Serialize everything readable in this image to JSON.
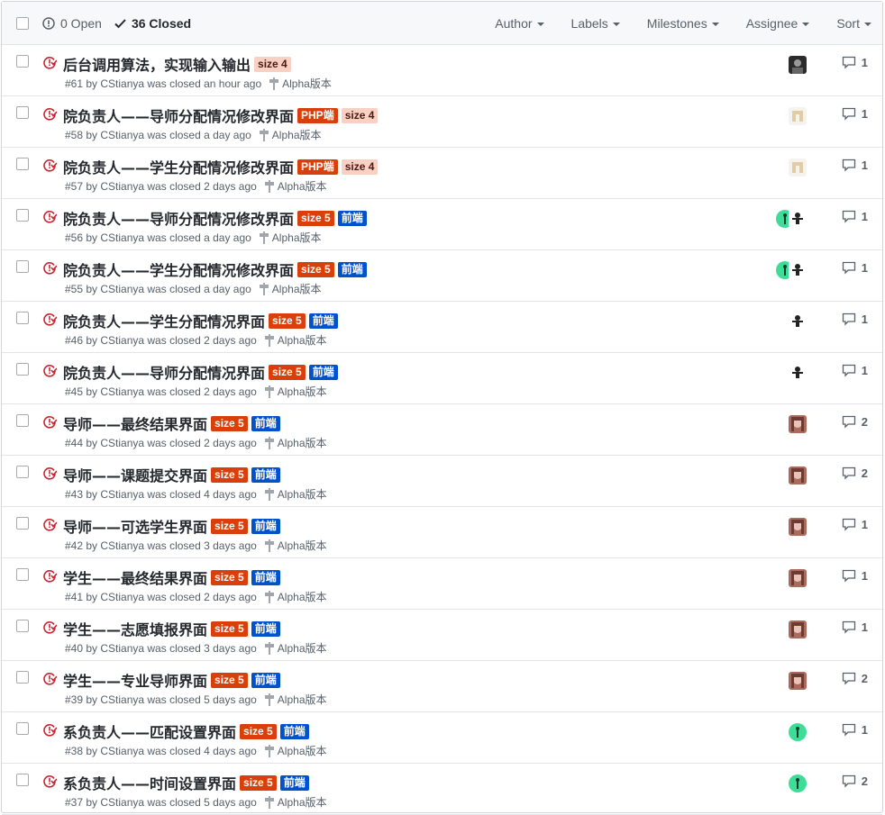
{
  "header": {
    "open_label": "0 Open",
    "closed_label": "36 Closed",
    "filters": [
      "Author",
      "Labels",
      "Milestones",
      "Assignee",
      "Sort"
    ]
  },
  "label_colors": {
    "size 4": {
      "bg": "#f9d0c4",
      "fg": "#4a1a0f"
    },
    "size 5": {
      "bg": "#d93f0b",
      "fg": "#ffffff"
    },
    "PHP端": {
      "bg": "#d93f0b",
      "fg": "#ffffff"
    },
    "前端": {
      "bg": "#0052cc",
      "fg": "#ffffff"
    }
  },
  "closed_icon_color": "#cb2431",
  "issues": [
    {
      "title": "后台调用算法，实现输入输出",
      "labels": [
        "size 4"
      ],
      "meta": "#61 by CStianya was closed an hour ago",
      "milestone": "Alpha版本",
      "avatars": [
        "dark-portrait-avatar"
      ],
      "comments": "1"
    },
    {
      "title": "院负责人——导师分配情况修改界面",
      "labels": [
        "PHP端",
        "size 4"
      ],
      "meta": "#58 by CStianya was closed a day ago",
      "milestone": "Alpha版本",
      "avatars": [
        "pixel-avatar"
      ],
      "comments": "1"
    },
    {
      "title": "院负责人——学生分配情况修改界面",
      "labels": [
        "PHP端",
        "size 4"
      ],
      "meta": "#57 by CStianya was closed 2 days ago",
      "milestone": "Alpha版本",
      "avatars": [
        "pixel-avatar"
      ],
      "comments": "1"
    },
    {
      "title": "院负责人——导师分配情况修改界面",
      "labels": [
        "size 5",
        "前端"
      ],
      "meta": "#56 by CStianya was closed a day ago",
      "milestone": "Alpha版本",
      "avatars": [
        "green-avatar",
        "figure-avatar"
      ],
      "comments": "1"
    },
    {
      "title": "院负责人——学生分配情况修改界面",
      "labels": [
        "size 5",
        "前端"
      ],
      "meta": "#55 by CStianya was closed a day ago",
      "milestone": "Alpha版本",
      "avatars": [
        "green-avatar",
        "figure-avatar"
      ],
      "comments": "1"
    },
    {
      "title": "院负责人——学生分配情况界面",
      "labels": [
        "size 5",
        "前端"
      ],
      "meta": "#46 by CStianya was closed 2 days ago",
      "milestone": "Alpha版本",
      "avatars": [
        "figure-avatar"
      ],
      "comments": "1"
    },
    {
      "title": "院负责人——导师分配情况界面",
      "labels": [
        "size 5",
        "前端"
      ],
      "meta": "#45 by CStianya was closed 2 days ago",
      "milestone": "Alpha版本",
      "avatars": [
        "figure-avatar"
      ],
      "comments": "1"
    },
    {
      "title": "导师——最终结果界面",
      "labels": [
        "size 5",
        "前端"
      ],
      "meta": "#44 by CStianya was closed 2 days ago",
      "milestone": "Alpha版本",
      "avatars": [
        "anime-avatar"
      ],
      "comments": "2"
    },
    {
      "title": "导师——课题提交界面",
      "labels": [
        "size 5",
        "前端"
      ],
      "meta": "#43 by CStianya was closed 4 days ago",
      "milestone": "Alpha版本",
      "avatars": [
        "anime-avatar"
      ],
      "comments": "2"
    },
    {
      "title": "导师——可选学生界面",
      "labels": [
        "size 5",
        "前端"
      ],
      "meta": "#42 by CStianya was closed 3 days ago",
      "milestone": "Alpha版本",
      "avatars": [
        "anime-avatar"
      ],
      "comments": "1"
    },
    {
      "title": "学生——最终结果界面",
      "labels": [
        "size 5",
        "前端"
      ],
      "meta": "#41 by CStianya was closed 2 days ago",
      "milestone": "Alpha版本",
      "avatars": [
        "anime-avatar"
      ],
      "comments": "1"
    },
    {
      "title": "学生——志愿填报界面",
      "labels": [
        "size 5",
        "前端"
      ],
      "meta": "#40 by CStianya was closed 3 days ago",
      "milestone": "Alpha版本",
      "avatars": [
        "anime-avatar"
      ],
      "comments": "1"
    },
    {
      "title": "学生——专业导师界面",
      "labels": [
        "size 5",
        "前端"
      ],
      "meta": "#39 by CStianya was closed 5 days ago",
      "milestone": "Alpha版本",
      "avatars": [
        "anime-avatar"
      ],
      "comments": "2"
    },
    {
      "title": "系负责人——匹配设置界面",
      "labels": [
        "size 5",
        "前端"
      ],
      "meta": "#38 by CStianya was closed 4 days ago",
      "milestone": "Alpha版本",
      "avatars": [
        "green-avatar"
      ],
      "comments": "1"
    },
    {
      "title": "系负责人——时间设置界面",
      "labels": [
        "size 5",
        "前端"
      ],
      "meta": "#37 by CStianya was closed 5 days ago",
      "milestone": "Alpha版本",
      "avatars": [
        "green-avatar"
      ],
      "comments": "2"
    }
  ]
}
